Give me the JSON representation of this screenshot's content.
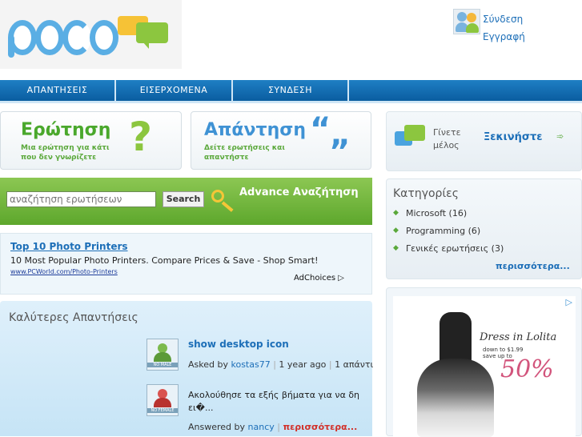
{
  "header": {
    "logo_text": "poco",
    "login_label": "Σύνδεση",
    "register_label": "Εγγραφή"
  },
  "nav": {
    "tabs": [
      {
        "label": "ΑΠΑΝΤΗΣΕΙΣ"
      },
      {
        "label": "ΕΙΣΕΡΧΟΜΕΝΑ"
      },
      {
        "label": "ΣΥΝΔΕΣΗ"
      }
    ]
  },
  "promo": {
    "question_title": "Ερώτηση",
    "question_sub": "Μια ερώτηση για κάτι που δεν γνωρίζετε",
    "answer_title": "Απάντηση",
    "answer_sub": "Δείτε ερωτήσεις και απαντήστε"
  },
  "search": {
    "placeholder": "αναζήτηση ερωτήσεων",
    "button_label": "Search",
    "advance_label": "Advance Αναζήτηση"
  },
  "ad": {
    "title": "Top 10 Photo Printers",
    "text": "10 Most Popular Photo Printers. Compare Prices & Save - Shop Smart!",
    "url": "www.PCWorld.com/Photo-Printers",
    "adchoices": "AdChoices"
  },
  "best_answers": {
    "heading": "Καλύτερες Απαντήσεις",
    "items": [
      {
        "avatar_caption": "NO MALE",
        "title": "show desktop icon",
        "asked_by_label": "Asked by",
        "user": "kostas77",
        "time": "1 year ago",
        "answers": "1 απάντι"
      },
      {
        "avatar_caption": "NO FEMALE",
        "text": "Ακολούθησε τα εξής βήματα για να δη ει�...",
        "answered_by_label": "Answered by",
        "user": "nancy",
        "more_label": "περισσότερα..."
      }
    ]
  },
  "sidebar": {
    "join_text": "Γίνετε μέλος",
    "start_label": "Ξεκινήστε",
    "categories_heading": "Κατηγορίες",
    "categories": [
      {
        "label": "Microsoft (16)"
      },
      {
        "label": "Programming (6)"
      },
      {
        "label": "Γενικές ερωτήσεις (3)"
      }
    ],
    "more_label": "περισσότερα..."
  },
  "banner": {
    "line1": "Dress in Lolita",
    "line2": "down to $1.99",
    "line3": "save up to",
    "percent": "50%"
  },
  "colors": {
    "brand_blue": "#1f7fc4",
    "brand_green": "#5da72c",
    "link_blue": "#1d6fb8",
    "more_red": "#d2312a"
  }
}
